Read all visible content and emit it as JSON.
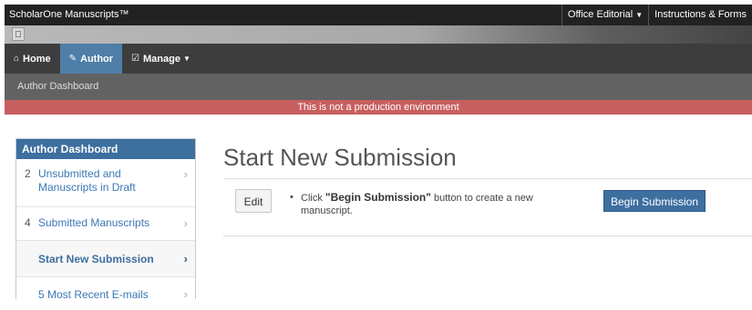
{
  "topbar": {
    "app_title": "ScholarOne Manuscripts™",
    "office_editorial": "Office Editorial",
    "instructions_forms": "Instructions & Forms"
  },
  "nav": {
    "home": "Home",
    "author": "Author",
    "manage": "Manage"
  },
  "subnav": {
    "title": "Author Dashboard"
  },
  "warning_banner": "This is not a production environment",
  "sidebar": {
    "header": "Author Dashboard",
    "items": [
      {
        "count": "2",
        "label": "Unsubmitted and Manuscripts in Draft"
      },
      {
        "count": "4",
        "label": "Submitted Manuscripts"
      },
      {
        "count": "",
        "label": "Start New Submission"
      },
      {
        "count": "",
        "label": "5 Most Recent E-mails"
      }
    ]
  },
  "main": {
    "title": "Start New Submission",
    "edit_button": "Edit",
    "instruction_prefix": "Click ",
    "instruction_bold": "\"Begin Submission\"",
    "instruction_suffix": " button to create a new",
    "instruction_line2": "manuscript.",
    "begin_button": "Begin Submission"
  },
  "colors": {
    "accent": "#3d6f9f",
    "nav_active": "#4f7ea8",
    "warning": "#c85f5f",
    "topbar": "#222222"
  }
}
